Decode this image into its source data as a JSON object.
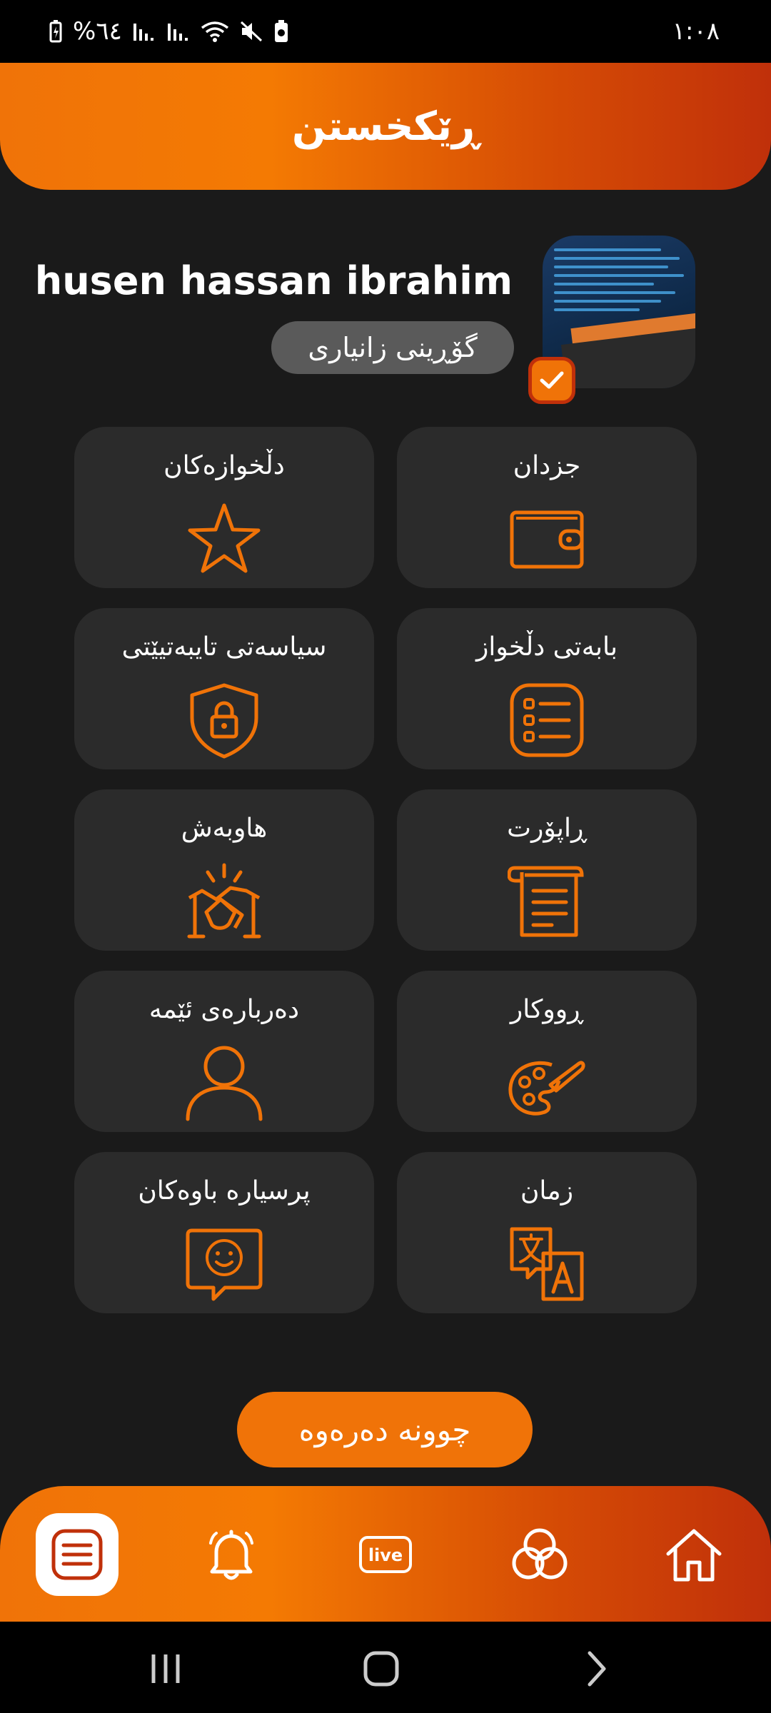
{
  "status_bar": {
    "battery": "%٦٤",
    "time": "١:٠٨"
  },
  "header": {
    "title": "ڕێکخستن"
  },
  "profile": {
    "name": "husen hassan ibrahim",
    "edit_label": "گۆڕینی  زانیاری"
  },
  "menu": [
    {
      "label": "جزدان",
      "icon": "wallet-icon"
    },
    {
      "label": "دڵخوازەکان",
      "icon": "star-icon"
    },
    {
      "label": "بابەتی دڵخواز",
      "icon": "list-icon"
    },
    {
      "label": "سیاسەتی تایبەتیێتی",
      "icon": "shield-lock-icon"
    },
    {
      "label": "ڕاپۆرت",
      "icon": "document-icon"
    },
    {
      "label": "هاوبەش",
      "icon": "handshake-icon"
    },
    {
      "label": "ڕووکار",
      "icon": "palette-icon"
    },
    {
      "label": "دەربارەی ئێمە",
      "icon": "person-icon"
    },
    {
      "label": "زمان",
      "icon": "translate-icon"
    },
    {
      "label": "پرسیارە باوەکان",
      "icon": "chat-smile-icon"
    }
  ],
  "logout_label": "چوونە دەرەوە",
  "bottom_nav": {
    "items": [
      "menu-icon",
      "bell-icon",
      "live-icon",
      "circles-icon",
      "home-icon"
    ],
    "live_text": "live"
  },
  "colors": {
    "accent": "#f07308",
    "accent_dark": "#c0300a",
    "background": "#1a1a1a",
    "card": "#2b2b2b"
  }
}
